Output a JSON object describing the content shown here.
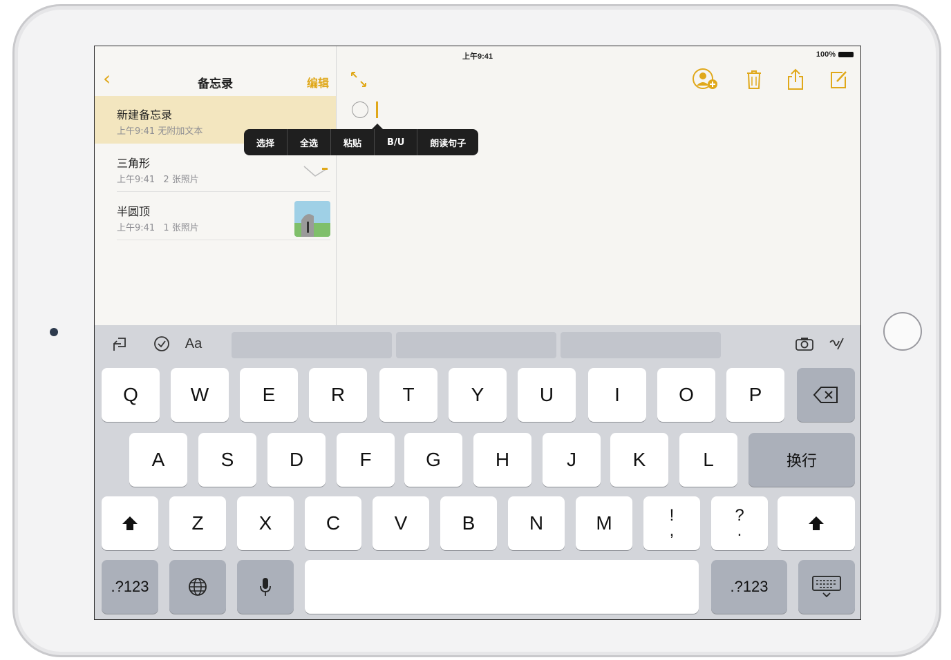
{
  "status_bar": {
    "device": "iPad",
    "time": "上午9:41",
    "battery": "100%"
  },
  "sidebar": {
    "title": "备忘录",
    "edit_label": "编辑",
    "notes": [
      {
        "title": "新建备忘录",
        "time": "上午9:41",
        "detail": "无附加文本"
      },
      {
        "title": "三角形",
        "time": "上午9:41",
        "detail": "2 张照片"
      },
      {
        "title": "半圆顶",
        "time": "上午9:41",
        "detail": "1 张照片"
      }
    ]
  },
  "callout_menu": [
    "选择",
    "全选",
    "粘贴",
    "B/U",
    "朗读句子"
  ],
  "keyboard": {
    "row1": [
      "Q",
      "W",
      "E",
      "R",
      "T",
      "Y",
      "U",
      "I",
      "O",
      "P"
    ],
    "row2": [
      "A",
      "S",
      "D",
      "F",
      "G",
      "H",
      "J",
      "K",
      "L"
    ],
    "return_label": "换行",
    "row3": [
      "Z",
      "X",
      "C",
      "V",
      "B",
      "N",
      "M"
    ],
    "punct1": {
      "top": "!",
      "bottom": ","
    },
    "punct2": {
      "top": "?",
      "bottom": "."
    },
    "numbers_label": ".?123",
    "shortcut_icons": [
      "undo-icon",
      "checklist-icon",
      "text-format-icon",
      "camera-icon",
      "sketch-icon"
    ]
  },
  "colors": {
    "accent": "#e0a81a",
    "selected_row": "#f3e6bf",
    "keyboard_bg": "#d3d5da"
  }
}
